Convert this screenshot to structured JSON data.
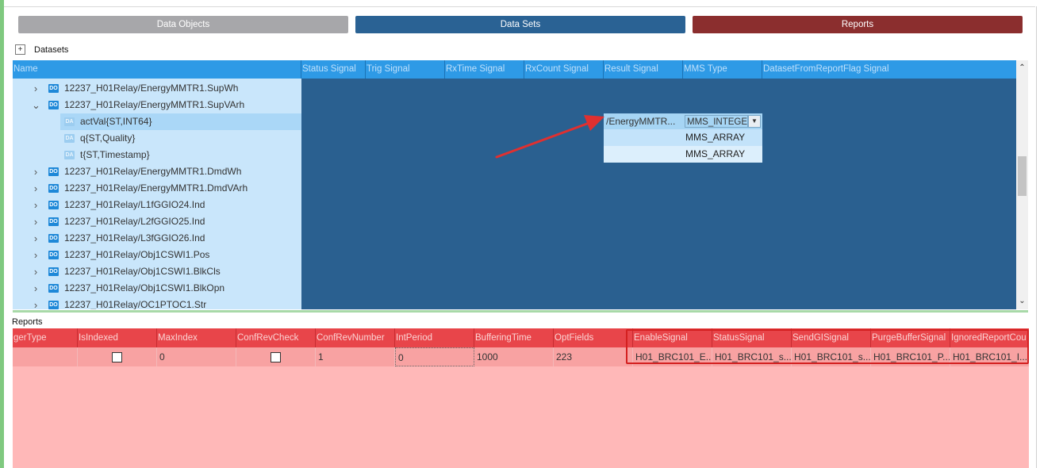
{
  "tabs": {
    "data_objects": "Data Objects",
    "data_sets": "Data Sets",
    "reports": "Reports"
  },
  "datasets": {
    "expand_glyph": "+",
    "title": "Datasets",
    "columns": [
      "Name",
      "Status Signal",
      "Trig Signal",
      "RxTime Signal",
      "RxCount Signal",
      "Result Signal",
      "MMS Type",
      "DatasetFromReportFlag Signal"
    ],
    "rows": [
      {
        "chevron": "›",
        "badge": "DO",
        "label": "12237_H01Relay/EnergyMMTR1.SupWh"
      },
      {
        "chevron": "⌄",
        "badge": "DO",
        "label": "12237_H01Relay/EnergyMMTR1.SupVArh"
      },
      {
        "chevron": "",
        "badge": "DA",
        "label": "actVal{ST,INT64}"
      },
      {
        "chevron": "",
        "badge": "DA",
        "label": "q{ST,Quality}"
      },
      {
        "chevron": "",
        "badge": "DA",
        "label": "t{ST,Timestamp}"
      },
      {
        "chevron": "›",
        "badge": "DO",
        "label": "12237_H01Relay/EnergyMMTR1.DmdWh"
      },
      {
        "chevron": "›",
        "badge": "DO",
        "label": "12237_H01Relay/EnergyMMTR1.DmdVArh"
      },
      {
        "chevron": "›",
        "badge": "DO",
        "label": "12237_H01Relay/L1fGGIO24.Ind"
      },
      {
        "chevron": "›",
        "badge": "DO",
        "label": "12237_H01Relay/L2fGGIO25.Ind"
      },
      {
        "chevron": "›",
        "badge": "DO",
        "label": "12237_H01Relay/L3fGGIO26.Ind"
      },
      {
        "chevron": "›",
        "badge": "DO",
        "label": "12237_H01Relay/Obj1CSWI1.Pos"
      },
      {
        "chevron": "›",
        "badge": "DO",
        "label": "12237_H01Relay/Obj1CSWI1.BlkCls"
      },
      {
        "chevron": "›",
        "badge": "DO",
        "label": "12237_H01Relay/Obj1CSWI1.BlkOpn"
      },
      {
        "chevron": "›",
        "badge": "DO",
        "label": "12237_H01Relay/OC1PTOC1.Str"
      }
    ],
    "editor": {
      "result_signal": "/EnergyMMTR...",
      "mms_type": "MMS_INTEGE",
      "dropdown_arrow": "▼",
      "options": [
        "MMS_ARRAY",
        "MMS_ARRAY"
      ]
    },
    "scroll_up": "⌃",
    "scroll_down": "⌄"
  },
  "reports": {
    "title": "Reports",
    "columns": [
      "gerType",
      "IsIndexed",
      "MaxIndex",
      "ConfRevCheck",
      "ConfRevNumber",
      "IntPeriod",
      "BufferingTime",
      "OptFields",
      "EnableSignal",
      "StatusSignal",
      "SendGISignal",
      "PurgeBufferSignal",
      "IgnoredReportCou"
    ],
    "row": {
      "max_index": "0",
      "conf_rev_number": "1",
      "int_period": "0",
      "buffering_time": "1000",
      "opt_fields": "223",
      "enable_signal": "H01_BRC101_E...",
      "status_signal": "H01_BRC101_s...",
      "send_gi_signal": "H01_BRC101_s...",
      "purge_buffer_signal": "H01_BRC101_P...",
      "ignored_report_count": "H01_BRC101_I..."
    }
  },
  "colors": {
    "data_objects_tab": "#a7a7aa",
    "data_sets_tab": "#2a6294",
    "reports_tab": "#8b2e2e",
    "dataset_grid": "#2a6090",
    "report_header": "#e8454a",
    "annotation_red": "#e03030"
  }
}
